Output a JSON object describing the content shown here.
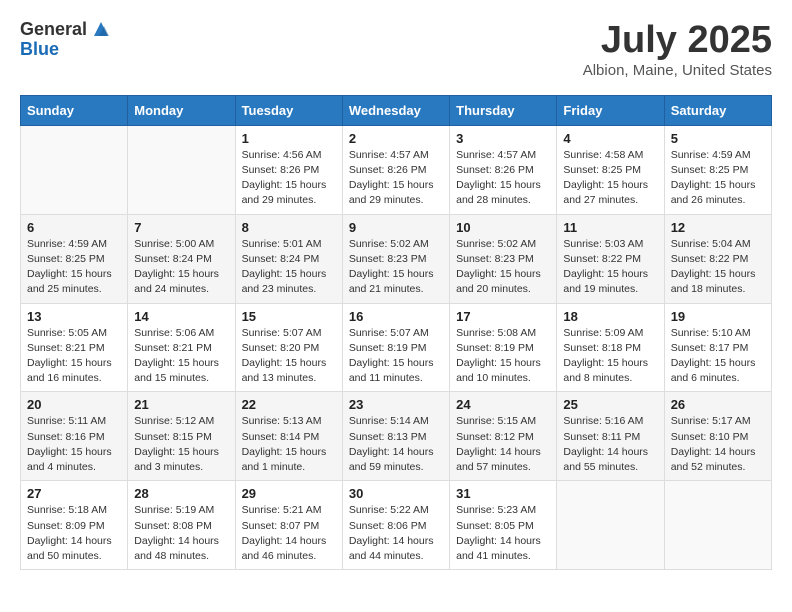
{
  "header": {
    "logo_general": "General",
    "logo_blue": "Blue",
    "month_year": "July 2025",
    "location": "Albion, Maine, United States"
  },
  "weekdays": [
    "Sunday",
    "Monday",
    "Tuesday",
    "Wednesday",
    "Thursday",
    "Friday",
    "Saturday"
  ],
  "weeks": [
    [
      {
        "day": "",
        "info": ""
      },
      {
        "day": "",
        "info": ""
      },
      {
        "day": "1",
        "info": "Sunrise: 4:56 AM\nSunset: 8:26 PM\nDaylight: 15 hours\nand 29 minutes."
      },
      {
        "day": "2",
        "info": "Sunrise: 4:57 AM\nSunset: 8:26 PM\nDaylight: 15 hours\nand 29 minutes."
      },
      {
        "day": "3",
        "info": "Sunrise: 4:57 AM\nSunset: 8:26 PM\nDaylight: 15 hours\nand 28 minutes."
      },
      {
        "day": "4",
        "info": "Sunrise: 4:58 AM\nSunset: 8:25 PM\nDaylight: 15 hours\nand 27 minutes."
      },
      {
        "day": "5",
        "info": "Sunrise: 4:59 AM\nSunset: 8:25 PM\nDaylight: 15 hours\nand 26 minutes."
      }
    ],
    [
      {
        "day": "6",
        "info": "Sunrise: 4:59 AM\nSunset: 8:25 PM\nDaylight: 15 hours\nand 25 minutes."
      },
      {
        "day": "7",
        "info": "Sunrise: 5:00 AM\nSunset: 8:24 PM\nDaylight: 15 hours\nand 24 minutes."
      },
      {
        "day": "8",
        "info": "Sunrise: 5:01 AM\nSunset: 8:24 PM\nDaylight: 15 hours\nand 23 minutes."
      },
      {
        "day": "9",
        "info": "Sunrise: 5:02 AM\nSunset: 8:23 PM\nDaylight: 15 hours\nand 21 minutes."
      },
      {
        "day": "10",
        "info": "Sunrise: 5:02 AM\nSunset: 8:23 PM\nDaylight: 15 hours\nand 20 minutes."
      },
      {
        "day": "11",
        "info": "Sunrise: 5:03 AM\nSunset: 8:22 PM\nDaylight: 15 hours\nand 19 minutes."
      },
      {
        "day": "12",
        "info": "Sunrise: 5:04 AM\nSunset: 8:22 PM\nDaylight: 15 hours\nand 18 minutes."
      }
    ],
    [
      {
        "day": "13",
        "info": "Sunrise: 5:05 AM\nSunset: 8:21 PM\nDaylight: 15 hours\nand 16 minutes."
      },
      {
        "day": "14",
        "info": "Sunrise: 5:06 AM\nSunset: 8:21 PM\nDaylight: 15 hours\nand 15 minutes."
      },
      {
        "day": "15",
        "info": "Sunrise: 5:07 AM\nSunset: 8:20 PM\nDaylight: 15 hours\nand 13 minutes."
      },
      {
        "day": "16",
        "info": "Sunrise: 5:07 AM\nSunset: 8:19 PM\nDaylight: 15 hours\nand 11 minutes."
      },
      {
        "day": "17",
        "info": "Sunrise: 5:08 AM\nSunset: 8:19 PM\nDaylight: 15 hours\nand 10 minutes."
      },
      {
        "day": "18",
        "info": "Sunrise: 5:09 AM\nSunset: 8:18 PM\nDaylight: 15 hours\nand 8 minutes."
      },
      {
        "day": "19",
        "info": "Sunrise: 5:10 AM\nSunset: 8:17 PM\nDaylight: 15 hours\nand 6 minutes."
      }
    ],
    [
      {
        "day": "20",
        "info": "Sunrise: 5:11 AM\nSunset: 8:16 PM\nDaylight: 15 hours\nand 4 minutes."
      },
      {
        "day": "21",
        "info": "Sunrise: 5:12 AM\nSunset: 8:15 PM\nDaylight: 15 hours\nand 3 minutes."
      },
      {
        "day": "22",
        "info": "Sunrise: 5:13 AM\nSunset: 8:14 PM\nDaylight: 15 hours\nand 1 minute."
      },
      {
        "day": "23",
        "info": "Sunrise: 5:14 AM\nSunset: 8:13 PM\nDaylight: 14 hours\nand 59 minutes."
      },
      {
        "day": "24",
        "info": "Sunrise: 5:15 AM\nSunset: 8:12 PM\nDaylight: 14 hours\nand 57 minutes."
      },
      {
        "day": "25",
        "info": "Sunrise: 5:16 AM\nSunset: 8:11 PM\nDaylight: 14 hours\nand 55 minutes."
      },
      {
        "day": "26",
        "info": "Sunrise: 5:17 AM\nSunset: 8:10 PM\nDaylight: 14 hours\nand 52 minutes."
      }
    ],
    [
      {
        "day": "27",
        "info": "Sunrise: 5:18 AM\nSunset: 8:09 PM\nDaylight: 14 hours\nand 50 minutes."
      },
      {
        "day": "28",
        "info": "Sunrise: 5:19 AM\nSunset: 8:08 PM\nDaylight: 14 hours\nand 48 minutes."
      },
      {
        "day": "29",
        "info": "Sunrise: 5:21 AM\nSunset: 8:07 PM\nDaylight: 14 hours\nand 46 minutes."
      },
      {
        "day": "30",
        "info": "Sunrise: 5:22 AM\nSunset: 8:06 PM\nDaylight: 14 hours\nand 44 minutes."
      },
      {
        "day": "31",
        "info": "Sunrise: 5:23 AM\nSunset: 8:05 PM\nDaylight: 14 hours\nand 41 minutes."
      },
      {
        "day": "",
        "info": ""
      },
      {
        "day": "",
        "info": ""
      }
    ]
  ]
}
